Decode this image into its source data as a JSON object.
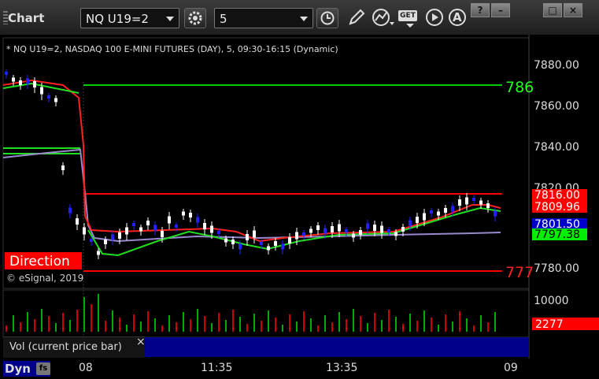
{
  "window": {
    "title": "Chart",
    "help": "?",
    "minimize": "–",
    "maximize": "□",
    "close": "×"
  },
  "toolbar": {
    "symbol": "NQ U19=2",
    "interval": "5",
    "icons": [
      "settings-icon",
      "clock-icon",
      "pencil-icon",
      "study-icon",
      "get-icon",
      "play-icon",
      "alert-icon"
    ],
    "get_label": "GET",
    "alert_label": "A"
  },
  "chart_header": "* NQ U19=2, NASDAQ 100 E-MINI FUTURES (DAY), 5, 09:30-16:15 (Dynamic)",
  "copyright": "© eSignal, 2019",
  "direction_label": "Direction",
  "price_axis": [
    "7880.00",
    "7860.00",
    "7840.00",
    "7820.00",
    "7800.00",
    "7780.00"
  ],
  "price_tags": [
    {
      "text": "7816.00",
      "bg": "#ff0000",
      "fg": "#ffffff"
    },
    {
      "text": "7809.96",
      "bg": "#ff0000",
      "fg": "#ffffff"
    },
    {
      "text": "7801.50",
      "bg": "#0000cc",
      "fg": "#ffffff"
    },
    {
      "text": "7797.38",
      "bg": "#00ee00",
      "fg": "#000000"
    }
  ],
  "level_labels": [
    {
      "text": "786",
      "color": "#22ff22"
    },
    {
      "text": "777",
      "color": "#ff2222"
    }
  ],
  "volume_axis": {
    "top": "10000",
    "tag": "2277"
  },
  "volume_legend": "Vol (current price bar)",
  "volume_close": "×",
  "time_axis": [
    "08",
    "11:35",
    "13:35",
    "09"
  ],
  "dyn_label": "Dyn",
  "dyn_icon": "fs",
  "colors": {
    "up_candle": "#ffffff",
    "down_candle": "#2222ff",
    "ma_red": "#ff2020",
    "ma_green": "#22dd22",
    "ma_purple": "#9988cc",
    "level_green": "#00cc00",
    "level_red": "#ff0000",
    "vol_up": "#00aa00",
    "vol_down": "#cc0000"
  }
}
